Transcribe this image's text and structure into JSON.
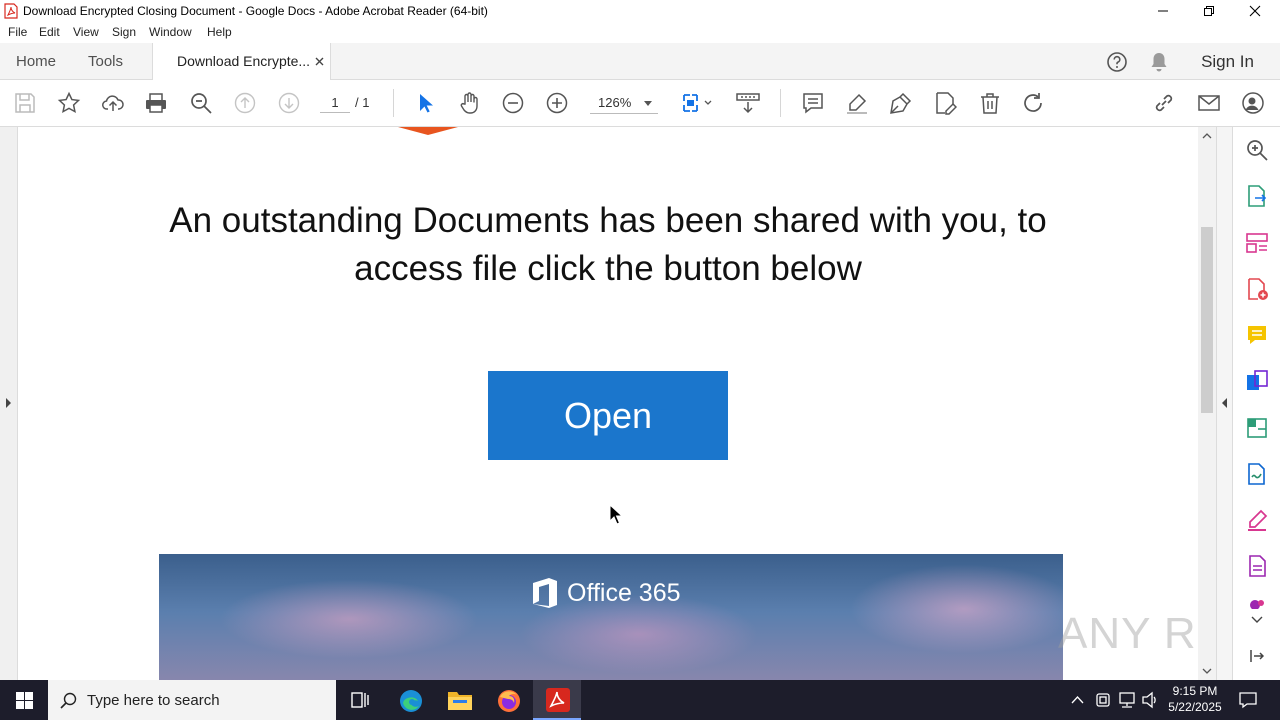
{
  "window": {
    "title": "Download Encrypted Closing Document - Google Docs - Adobe Acrobat Reader (64-bit)"
  },
  "menu": [
    "File",
    "Edit",
    "View",
    "Sign",
    "Window",
    "Help"
  ],
  "tabs": {
    "home": "Home",
    "tools": "Tools",
    "document": "Download Encrypte...",
    "sign_in": "Sign In"
  },
  "toolbar": {
    "page_current": "1",
    "page_total": "/ 1",
    "zoom": "126%"
  },
  "document": {
    "message": "An outstanding Documents has been shared with you, to access file click the button below",
    "button_label": "Open",
    "banner_text": "Office 365",
    "watermark": "ANY RUN"
  },
  "taskbar": {
    "search_placeholder": "Type here to search",
    "time": "9:15 PM",
    "date": "5/22/2025"
  },
  "colors": {
    "open_button": "#1b76cc",
    "acrobat_red": "#d7281e",
    "taskbar": "#1d1d2b"
  }
}
